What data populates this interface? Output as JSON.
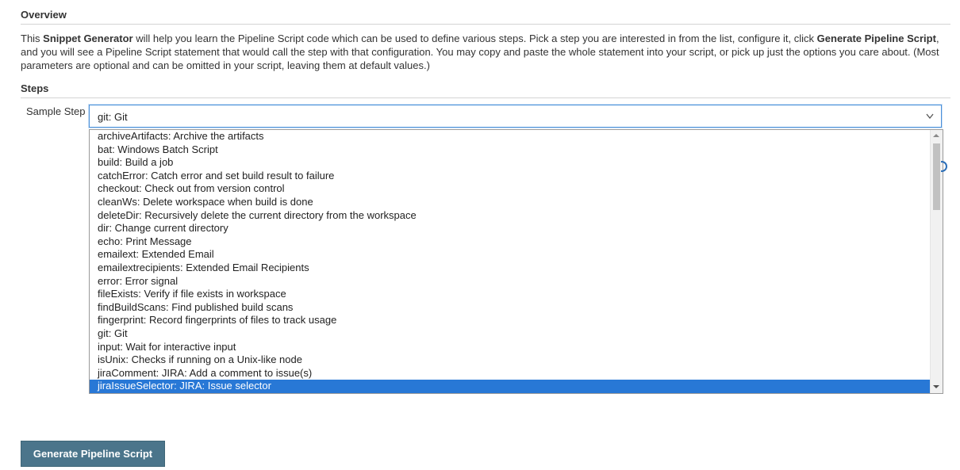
{
  "overview": {
    "title": "Overview",
    "desc_1": "This ",
    "desc_bold_1": "Snippet Generator",
    "desc_2": " will help you learn the Pipeline Script code which can be used to define various steps. Pick a step you are interested in from the list, configure it, click ",
    "desc_bold_2": "Generate Pipeline Script",
    "desc_3": ", and you will see a Pipeline Script statement that would call the step with that configuration. You may copy and paste the whole statement into your script, or pick up just the options you care about. (Most parameters are optional and can be omitted in your script, leaving them at default values.)"
  },
  "steps": {
    "title": "Steps",
    "sample_step_label": "Sample Step",
    "selected_value": "git: Git",
    "chevron_glyph": "v",
    "options": [
      "archiveArtifacts: Archive the artifacts",
      "bat: Windows Batch Script",
      "build: Build a job",
      "catchError: Catch error and set build result to failure",
      "checkout: Check out from version control",
      "cleanWs: Delete workspace when build is done",
      "deleteDir: Recursively delete the current directory from the workspace",
      "dir: Change current directory",
      "echo: Print Message",
      "emailext: Extended Email",
      "emailextrecipients: Extended Email Recipients",
      "error: Error signal",
      "fileExists: Verify if file exists in workspace",
      "findBuildScans: Find published build scans",
      "fingerprint: Record fingerprints of files to track usage",
      "git: Git",
      "input: Wait for interactive input",
      "isUnix: Checks if running on a Unix-like node",
      "jiraComment: JIRA: Add a comment to issue(s)",
      "jiraIssueSelector: JIRA: Issue selector"
    ],
    "highlighted_index": 19
  },
  "actions": {
    "generate_label": "Generate Pipeline Script"
  },
  "colors": {
    "selection": "#2878d6",
    "button": "#4b758b",
    "focus_border": "#4a90d9"
  }
}
